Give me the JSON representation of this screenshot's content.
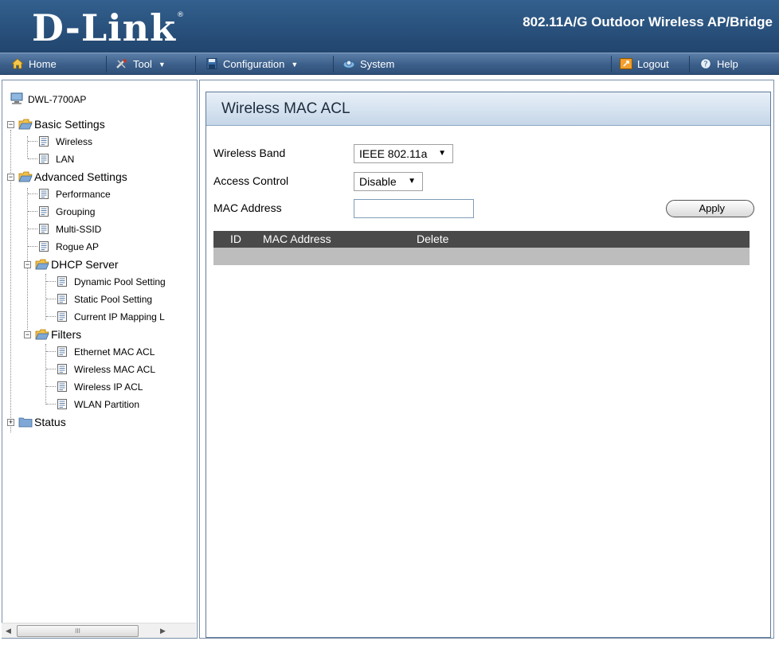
{
  "header": {
    "logo": "D-Link",
    "logo_mark": "®",
    "product_title": "802.11A/G Outdoor Wireless AP/Bridge"
  },
  "menu": {
    "home": "Home",
    "tool": "Tool",
    "configuration": "Configuration",
    "system": "System",
    "logout": "Logout",
    "help": "Help"
  },
  "tree": {
    "root": "DWL-7700AP",
    "basic_settings": "Basic Settings",
    "wireless": "Wireless",
    "lan": "LAN",
    "advanced_settings": "Advanced Settings",
    "performance": "Performance",
    "grouping": "Grouping",
    "multi_ssid": "Multi-SSID",
    "rogue_ap": "Rogue AP",
    "dhcp_server": "DHCP Server",
    "dynamic_pool": "Dynamic Pool Setting",
    "static_pool": "Static Pool Setting",
    "current_ip": "Current IP Mapping L",
    "filters": "Filters",
    "ethernet_mac_acl": "Ethernet MAC ACL",
    "wireless_mac_acl": "Wireless MAC ACL",
    "wireless_ip_acl": "Wireless IP ACL",
    "wlan_partition": "WLAN Partition",
    "status": "Status"
  },
  "scrollbar": {
    "grip": "III"
  },
  "content": {
    "title": "Wireless MAC ACL",
    "wireless_band_label": "Wireless Band",
    "wireless_band_value": "IEEE 802.11a",
    "access_control_label": "Access Control",
    "access_control_value": "Disable",
    "mac_address_label": "MAC Address",
    "mac_address_value": "",
    "apply_label": "Apply",
    "table": {
      "columns": [
        "ID",
        "MAC Address",
        "Delete"
      ],
      "rows": []
    }
  },
  "colors": {
    "header_bg": "#21456e",
    "menubar_bg": "#3b5f8a",
    "table_head_bg": "#4a4a4a",
    "table_row_bg": "#bdbdbd"
  }
}
